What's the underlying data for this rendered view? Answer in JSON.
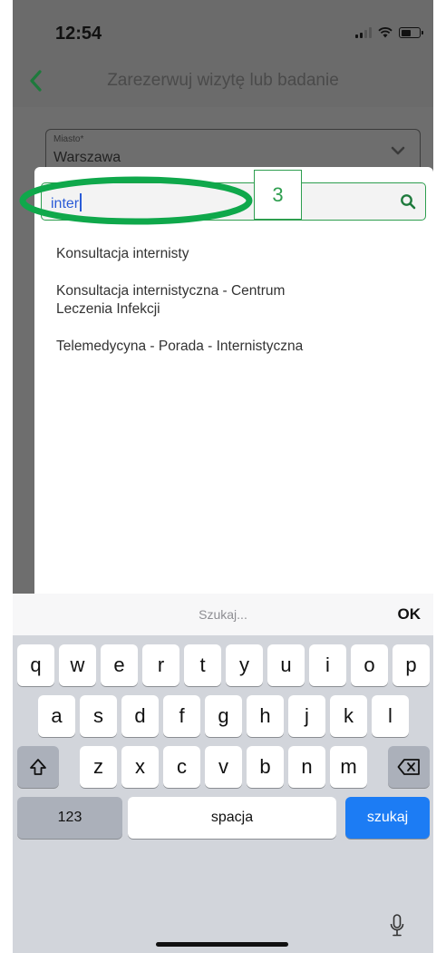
{
  "status_bar": {
    "time": "12:54"
  },
  "header": {
    "title": "Zarezerwuj wizytę lub badanie",
    "back_icon": "chevron-left-icon",
    "accent_color": "#2e9e4f"
  },
  "form": {
    "city_label": "Miasto*",
    "city_value": "Warszawa"
  },
  "modal": {
    "search_value": "inter",
    "search_icon": "search-icon",
    "results": [
      {
        "line1": "Konsultacja internisty",
        "line2": ""
      },
      {
        "line1": "Konsultacja internistyczna - Centrum",
        "line2": "Leczenia Infekcji"
      },
      {
        "line1": "Telemedycyna - Porada - Internistyczna",
        "line2": ""
      }
    ]
  },
  "annotation": {
    "step_number": "3",
    "color": "#0fa84b"
  },
  "keyboard": {
    "placeholder": "Szukaj...",
    "ok_label": "OK",
    "row1": [
      "q",
      "w",
      "e",
      "r",
      "t",
      "y",
      "u",
      "i",
      "o",
      "p"
    ],
    "row2": [
      "a",
      "s",
      "d",
      "f",
      "g",
      "h",
      "j",
      "k",
      "l"
    ],
    "row3": [
      "z",
      "x",
      "c",
      "v",
      "b",
      "n",
      "m"
    ],
    "numbers_label": "123",
    "space_label": "spacja",
    "search_label": "szukaj",
    "shift_icon": "shift-icon",
    "backspace_icon": "backspace-icon",
    "mic_icon": "microphone-icon"
  }
}
